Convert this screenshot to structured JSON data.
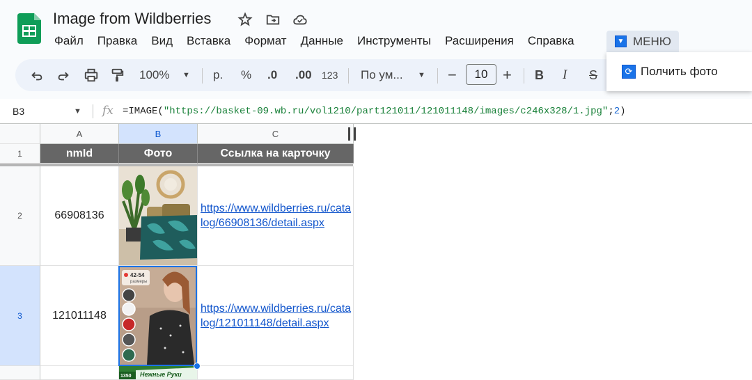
{
  "doc": {
    "title": "Image from Wildberries"
  },
  "menu": {
    "items": [
      "Файл",
      "Правка",
      "Вид",
      "Вставка",
      "Формат",
      "Данные",
      "Инструменты",
      "Расширения",
      "Справка"
    ],
    "custom": "МЕНЮ"
  },
  "dropdown": {
    "item": "Полчить фото"
  },
  "toolbar": {
    "zoom": "100%",
    "currency": "р.",
    "percent": "%",
    "dec_decrease": ".0",
    "dec_increase": ".00",
    "number_format": "123",
    "font": "По ум...",
    "font_size": "10",
    "minus": "−",
    "plus": "+",
    "bold": "B",
    "italic": "I",
    "strike": "S"
  },
  "formula_bar": {
    "cell_ref": "B3",
    "fx": "fx",
    "fn": "=IMAGE(",
    "url": "\"https://basket-09.wb.ru/vol1210/part121011/121011148/images/c246x328/1.jpg\"",
    "sep": ";",
    "arg": "2",
    "close": ")"
  },
  "columns": [
    "A",
    "B",
    "C"
  ],
  "rows": [
    "1",
    "2",
    "3"
  ],
  "header": {
    "a": "nmId",
    "b": "Фото",
    "c": "Ссылка на карточку"
  },
  "data": [
    {
      "nmid": "66908136",
      "link": "https://www.wildberries.ru/catalog/66908136/detail.aspx"
    },
    {
      "nmid": "121011148",
      "link": "https://www.wildberries.ru/catalog/121011148/detail.aspx"
    }
  ],
  "images": {
    "row3_badge": "42-54",
    "row3_badge_sub": "размеры",
    "row4_badge": "1350",
    "row4_text": "Нежные Руки"
  },
  "colors": {
    "accent": "#1a73e8",
    "header_bg": "#666666",
    "link": "#1155cc",
    "string": "#188038"
  }
}
